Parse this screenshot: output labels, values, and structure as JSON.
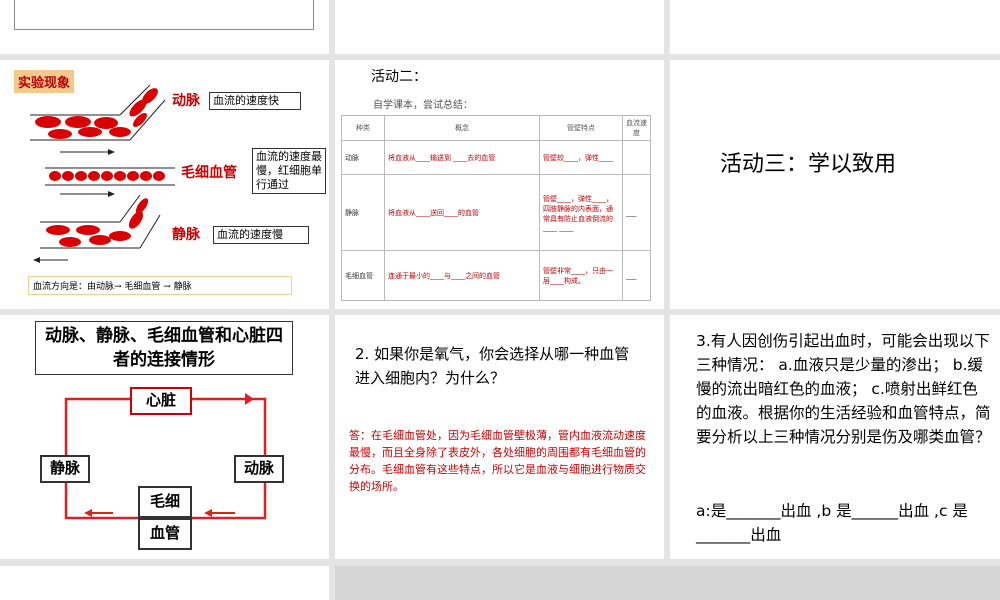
{
  "slide_observe": {
    "badge": "实验现象",
    "artery_label": "动脉",
    "artery_desc": "血流的速度快",
    "capillary_label": "毛细血管",
    "capillary_desc": "血流的速度最慢，红细胞单行通过",
    "vein_label": "静脉",
    "vein_desc": "血流的速度慢",
    "flow_direction": "血流方向是：由动脉→ 毛细血管 → 静脉"
  },
  "slide_activity2": {
    "title": "活动二：",
    "subtitle": "自学课本，尝试总结：",
    "headers": [
      "种类",
      "概念",
      "管壁特点",
      "血流速度"
    ],
    "rows": [
      {
        "type": "动脉",
        "concept": "将血液从____输送到 ____去的血管",
        "wall": "管壁较____，弹性____",
        "speed": ""
      },
      {
        "type": "静脉",
        "concept": "将血液从____送回____的血管",
        "wall": "管壁____，弹性____，四肢静脉的内表面，通常具有防止血液倒流的____ ____",
        "speed": "___"
      },
      {
        "type": "毛细血管",
        "concept": "连通于最小的____与____之间的血管",
        "wall": "管壁非常____，只由一层____构成。",
        "speed": "___"
      }
    ]
  },
  "slide_activity3": {
    "title": "活动三：学以致用"
  },
  "slide_connect": {
    "title": "动脉、静脉、毛细血管和心脏四者的连接情形",
    "heart": "心脏",
    "vein": "静脉",
    "artery": "动脉",
    "cap_1": "毛细",
    "cap_2": "血管"
  },
  "slide_q2": {
    "question": "2. 如果你是氧气，你会选择从哪一种血管进入细胞内？为什么？",
    "answer": "答：在毛细血管处，因为毛细血管壁极薄，管内血液流动速度最慢，而且全身除了表皮外，各处细胞的周围都有毛细血管的分布。毛细血管有这些特点，所以它是血液与细胞进行物质交换的场所。"
  },
  "slide_q3": {
    "text": "3.有人因创伤引起出血时，可能会出现以下三种情况： a.血液只是少量的渗出； b.缓慢的流出暗红色的血液； c.喷射出鲜红色的血液。根据你的生活经验和血管特点，简要分析以上三种情况分别是伤及哪类血管？",
    "blanks": "a:是_______出血 ,b 是______出血 ,c 是 _______出血"
  },
  "colors": {
    "accent_red": "#cc0000",
    "badge_bg": "#f3c98f",
    "cell_red": "#d80000"
  }
}
